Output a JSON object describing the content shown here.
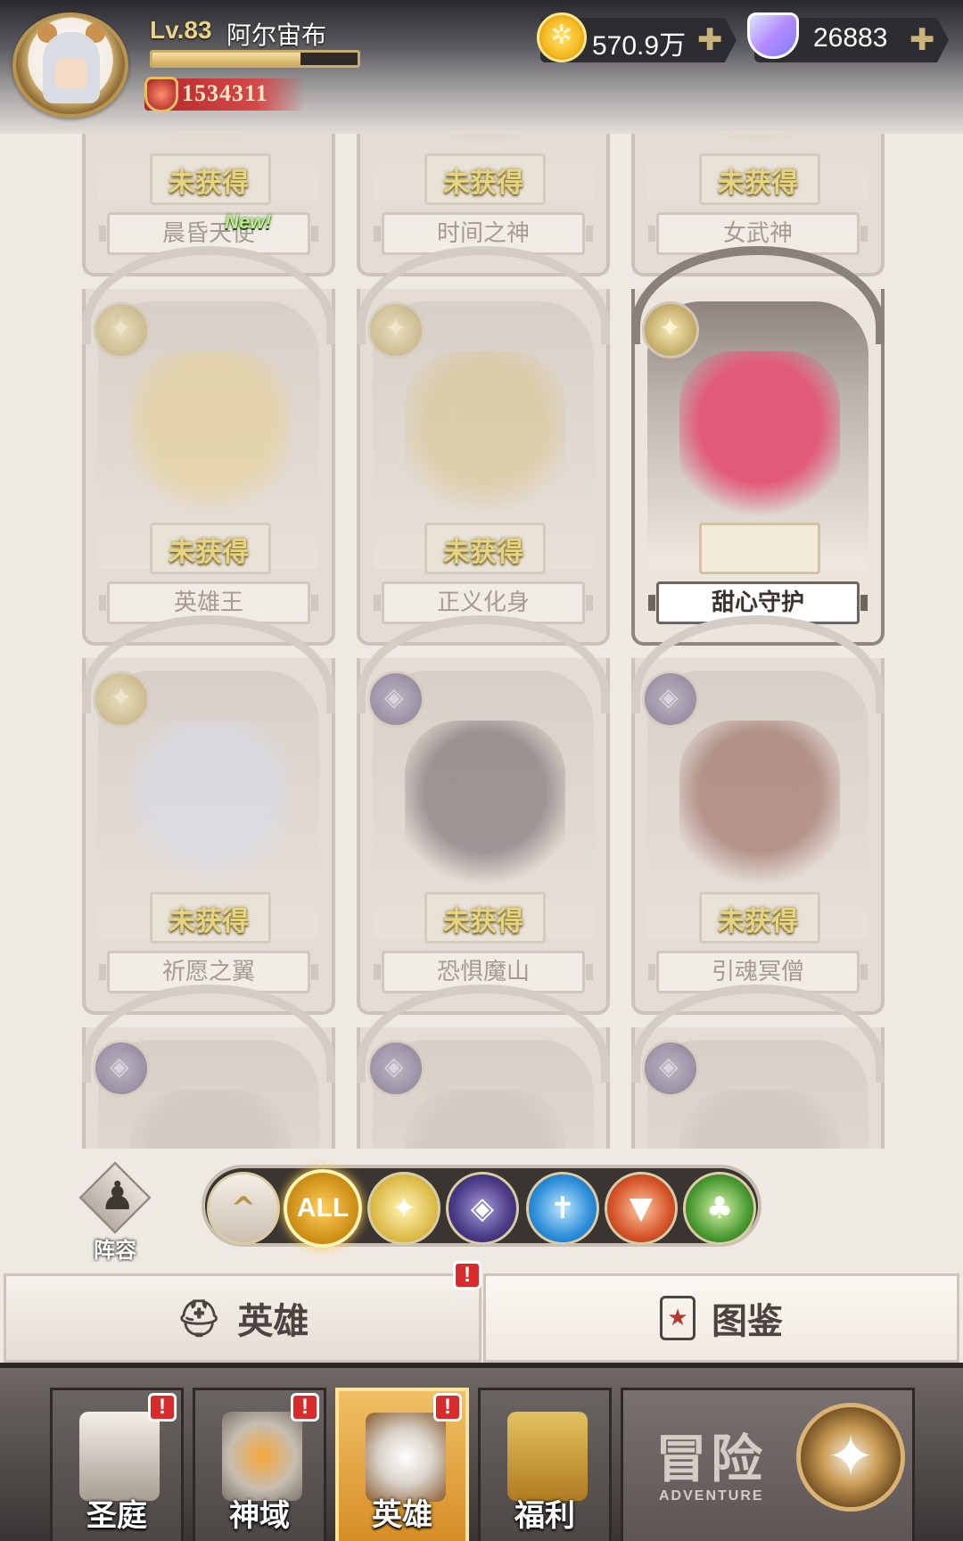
{
  "player": {
    "level": "Lv.83",
    "name": "阿尔宙布",
    "exp_fraction": 0.72,
    "power": "1534311"
  },
  "currency": {
    "gold": "570.9万",
    "gems": "26883",
    "plus": "✚"
  },
  "heroes": [
    {
      "name": "晨昏天使",
      "status": "未获得",
      "owned": false,
      "element": "none",
      "new_tag": "New!",
      "figure_color": "#d8c7b2"
    },
    {
      "name": "时间之神",
      "status": "未获得",
      "owned": false,
      "element": "none",
      "new_tag": "",
      "figure_color": "#c6bcb0"
    },
    {
      "name": "女武神",
      "status": "未获得",
      "owned": false,
      "element": "none",
      "new_tag": "",
      "figure_color": "#d6c497"
    },
    {
      "name": "英雄王",
      "status": "未获得",
      "owned": false,
      "element": "light",
      "new_tag": "",
      "figure_color": "#e7cf8e"
    },
    {
      "name": "正义化身",
      "status": "未获得",
      "owned": false,
      "element": "light",
      "new_tag": "",
      "figure_color": "#d9c48e"
    },
    {
      "name": "甜心守护",
      "status": "",
      "owned": true,
      "element": "light",
      "new_tag": "",
      "figure_color": "#e25a7a"
    },
    {
      "name": "祈愿之翼",
      "status": "未获得",
      "owned": false,
      "element": "light",
      "new_tag": "",
      "figure_color": "#d7dcee"
    },
    {
      "name": "恐惧魔山",
      "status": "未获得",
      "owned": false,
      "element": "dark",
      "new_tag": "",
      "figure_color": "#6a5c63"
    },
    {
      "name": "引魂冥僧",
      "status": "未获得",
      "owned": false,
      "element": "dark",
      "new_tag": "",
      "figure_color": "#8f5a52"
    },
    {
      "name": "",
      "status": "",
      "owned": false,
      "element": "dark",
      "new_tag": "",
      "figure_color": "#c9c1b8"
    },
    {
      "name": "",
      "status": "",
      "owned": false,
      "element": "dark",
      "new_tag": "",
      "figure_color": "#c9c1b8"
    },
    {
      "name": "",
      "status": "",
      "owned": false,
      "element": "dark",
      "new_tag": "",
      "figure_color": "#c9c1b8"
    }
  ],
  "filters": {
    "formation_label": "阵容",
    "collapse_icon": "^",
    "all_label": "ALL",
    "items": [
      "light-element-icon",
      "dark-element-icon",
      "water-element-icon",
      "fire-element-icon",
      "wood-element-icon"
    ]
  },
  "subtabs": {
    "heroes_label": "英雄",
    "codex_label": "图鉴",
    "alert": "!"
  },
  "nav": {
    "items": [
      {
        "label": "圣庭",
        "alert": "!"
      },
      {
        "label": "神域",
        "alert": "!"
      },
      {
        "label": "英雄",
        "alert": "!",
        "active": true
      },
      {
        "label": "福利",
        "alert": ""
      }
    ],
    "adventure_label": "冒险",
    "adventure_sub": "ADVENTURE"
  },
  "colors": {
    "accent_gold": "#d68d25",
    "alert_red": "#d92b2b",
    "status_text": "#e5d482"
  }
}
